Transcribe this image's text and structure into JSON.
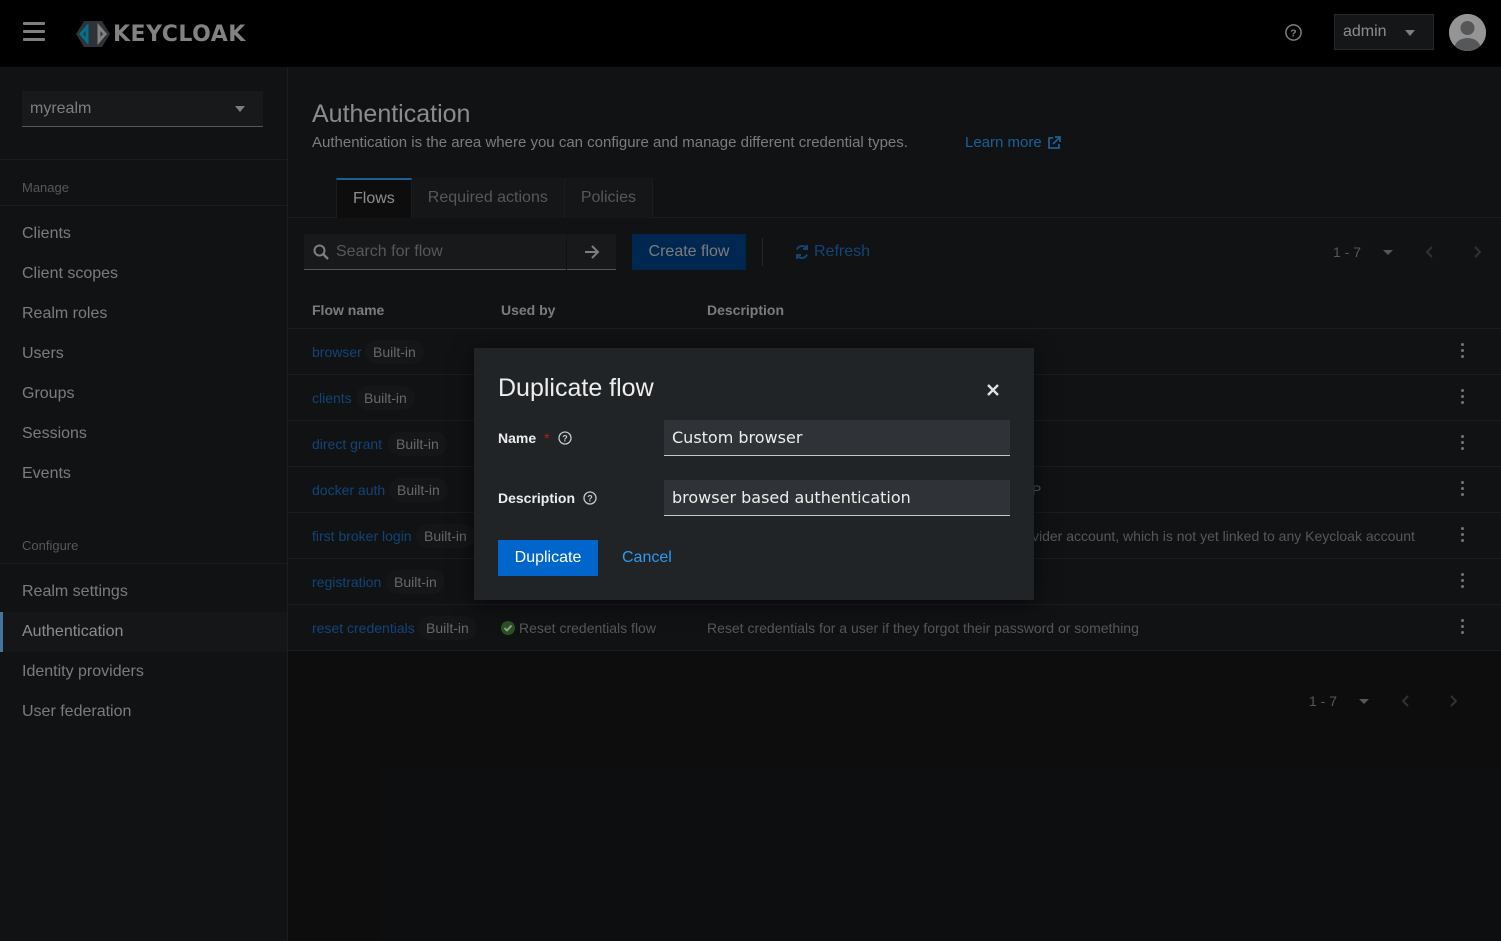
{
  "header": {
    "logo_text": "KEYCLOAK",
    "user_label": "admin"
  },
  "sidebar": {
    "realm": "myrealm",
    "manage_label": "Manage",
    "manage_items": [
      "Clients",
      "Client scopes",
      "Realm roles",
      "Users",
      "Groups",
      "Sessions",
      "Events"
    ],
    "configure_label": "Configure",
    "configure_items": [
      "Realm settings",
      "Authentication",
      "Identity providers",
      "User federation"
    ],
    "active_item": "Authentication"
  },
  "page": {
    "title": "Authentication",
    "description": "Authentication is the area where you can configure and manage different credential types.",
    "learn_more": "Learn more",
    "tabs": [
      "Flows",
      "Required actions",
      "Policies"
    ],
    "active_tab": "Flows"
  },
  "toolbar": {
    "search_placeholder": "Search for flow",
    "create_label": "Create flow",
    "refresh_label": "Refresh",
    "pagination": "1 - 7"
  },
  "table": {
    "columns": [
      "Flow name",
      "Used by",
      "Description"
    ],
    "rows": [
      {
        "name": "browser",
        "badge": "Built-in",
        "used_by": "",
        "description": ""
      },
      {
        "name": "clients",
        "badge": "Built-in",
        "used_by": "",
        "description": ""
      },
      {
        "name": "direct grant",
        "badge": "Built-in",
        "used_by": "",
        "description": ""
      },
      {
        "name": "docker auth",
        "badge": "Built-in",
        "used_by": "",
        "description": "P"
      },
      {
        "name": "first broker login",
        "badge": "Built-in",
        "used_by": "",
        "description": "vider account, which is not yet linked to any Keycloak account"
      },
      {
        "name": "registration",
        "badge": "Built-in",
        "used_by": "",
        "description": ""
      },
      {
        "name": "reset credentials",
        "badge": "Built-in",
        "used_by": "Reset credentials flow",
        "description": "Reset credentials for a user if they forgot their password or something"
      }
    ]
  },
  "bottom_pagination": "1 - 7",
  "modal": {
    "title": "Duplicate flow",
    "name_label": "Name",
    "required_mark": "*",
    "name_value": "Custom browser",
    "description_label": "Description",
    "description_value": "browser based authentication",
    "duplicate_label": "Duplicate",
    "cancel_label": "Cancel"
  },
  "colors": {
    "primary": "#0066cc",
    "link": "#2b9af3",
    "success": "#3e8635",
    "required": "#c9190b"
  }
}
